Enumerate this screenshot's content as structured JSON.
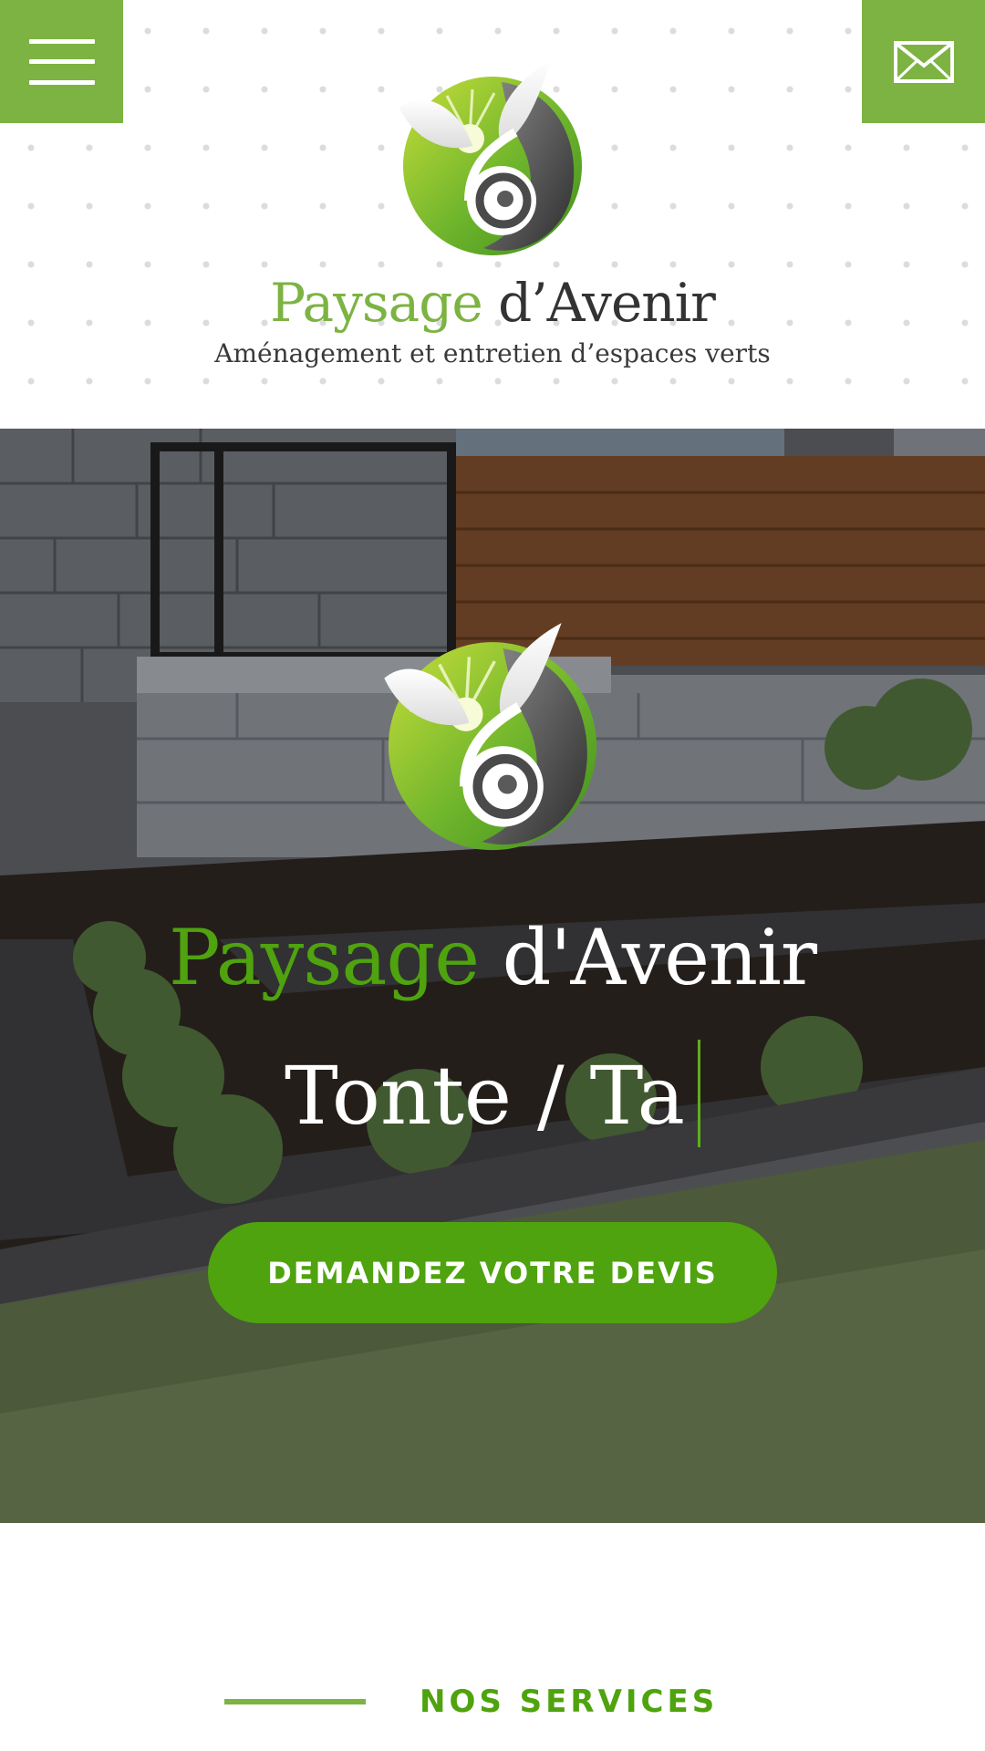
{
  "header": {
    "menu_icon": "hamburger-icon",
    "mail_icon": "envelope-icon",
    "brand_green": "Paysage",
    "brand_dark": "d’Avenir",
    "tagline": "Aménagement et entretien d’espaces verts"
  },
  "hero": {
    "brand_green": "Paysage",
    "brand_white": "d'Avenir",
    "typed_text": "Tonte / Ta",
    "cta_label": "DEMANDEZ VOTRE DEVIS"
  },
  "services": {
    "title": "NOS SERVICES"
  },
  "colors": {
    "brand_green": "#7cb342",
    "cta_green": "#4fa30e",
    "text_dark": "#333333"
  }
}
